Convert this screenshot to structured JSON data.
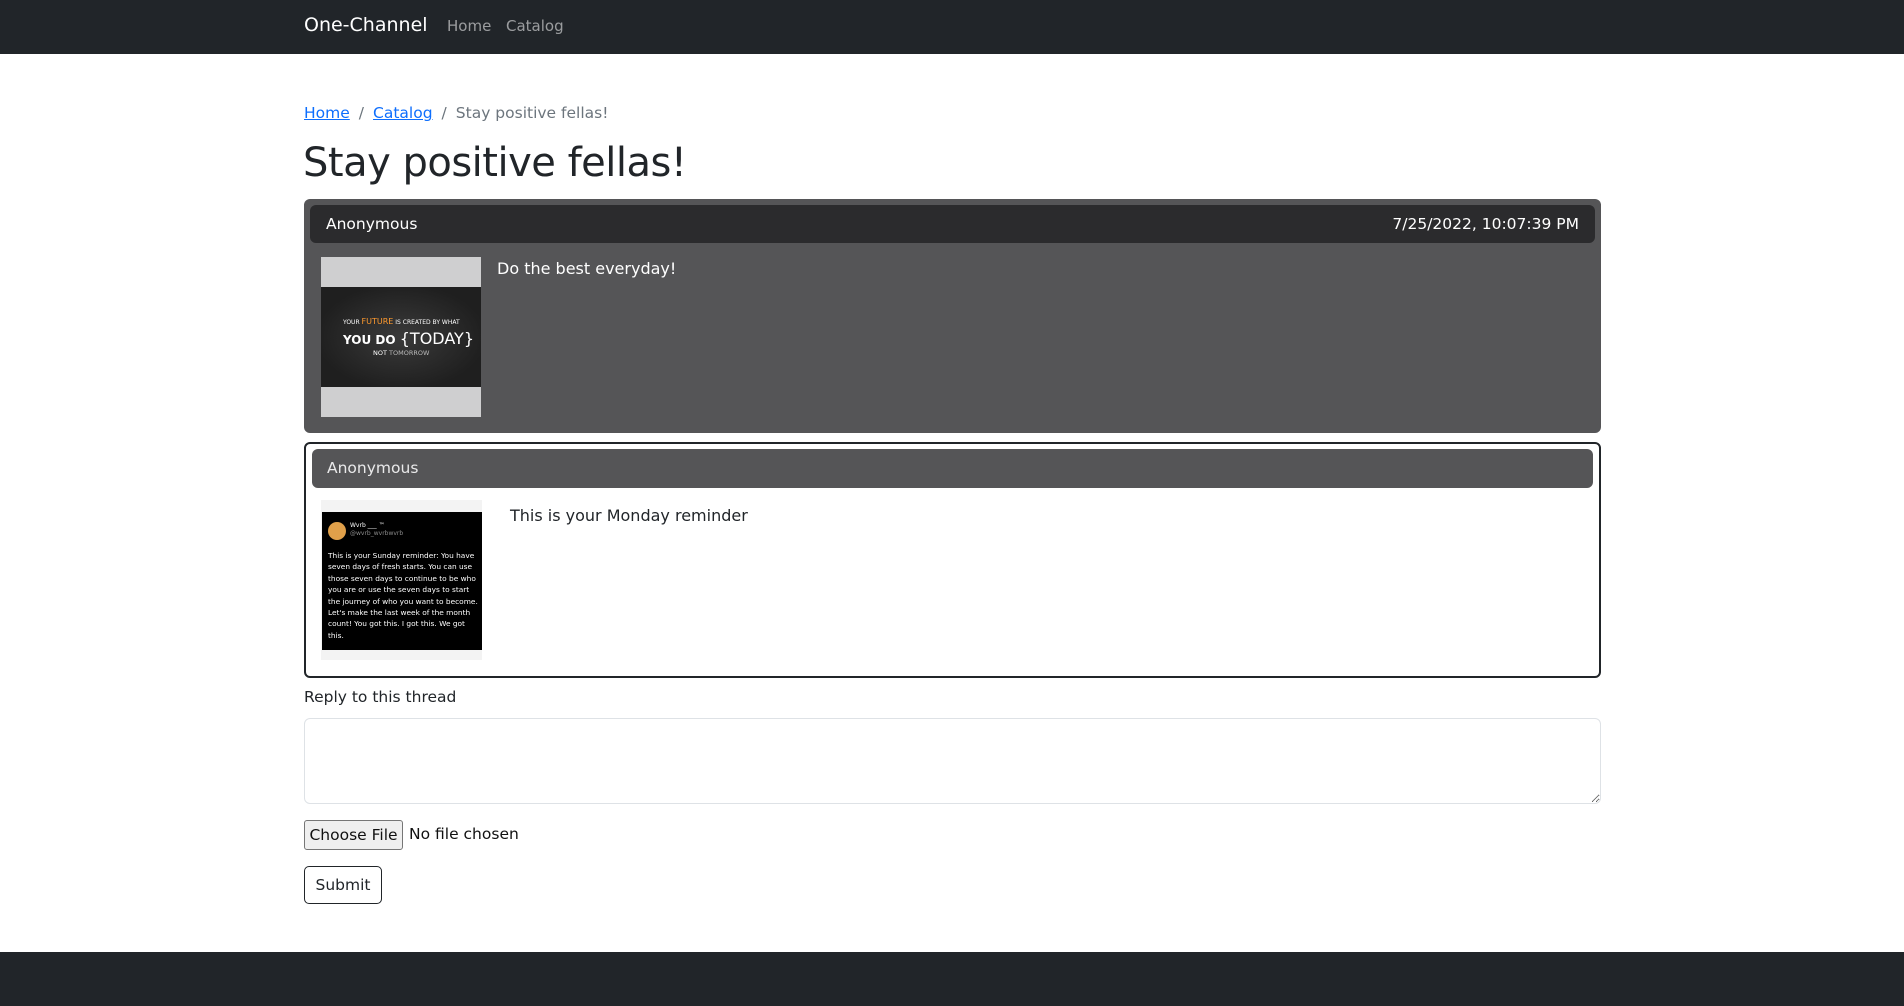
{
  "navbar": {
    "brand": "One-Channel",
    "links": [
      {
        "label": "Home"
      },
      {
        "label": "Catalog"
      }
    ]
  },
  "breadcrumb": {
    "items": [
      {
        "label": "Home"
      },
      {
        "label": "Catalog"
      }
    ],
    "separator": "/",
    "current": "Stay positive fellas!"
  },
  "thread": {
    "title": "Stay positive fellas!",
    "posts": [
      {
        "author": "Anonymous",
        "timestamp": "7/25/2022, 10:07:39 PM",
        "text": "Do the best everyday!",
        "image": {
          "type": "quote-poster",
          "lines": [
            "YOUR",
            "FUTURE",
            "IS CREATED BY WHAT",
            "YOU DO",
            "{",
            "TODAY",
            "}",
            "NOT",
            "TOMORROW"
          ]
        }
      },
      {
        "author": "Anonymous",
        "text": "This is your Monday reminder",
        "image": {
          "type": "tweet-screenshot",
          "name": "Wvrb ___ ™",
          "handle": "@wvrb_wvrbwvrb",
          "body": "This is your Sunday reminder: You have seven days of fresh starts. You can use those seven days to continue to be who you are or use the seven days to start the journey of who you want to become. Let's make the last week of the month count! You got this. I got this. We got this."
        }
      }
    ]
  },
  "reply": {
    "label": "Reply to this thread",
    "textarea_value": "",
    "file_button": "Choose File",
    "file_status": "No file chosen",
    "submit_label": "Submit"
  },
  "colors": {
    "navbar_bg": "#212529",
    "link": "#0d6efd",
    "post_dark_bg": "#555557",
    "post_header_dark": "#2b2b2d"
  }
}
